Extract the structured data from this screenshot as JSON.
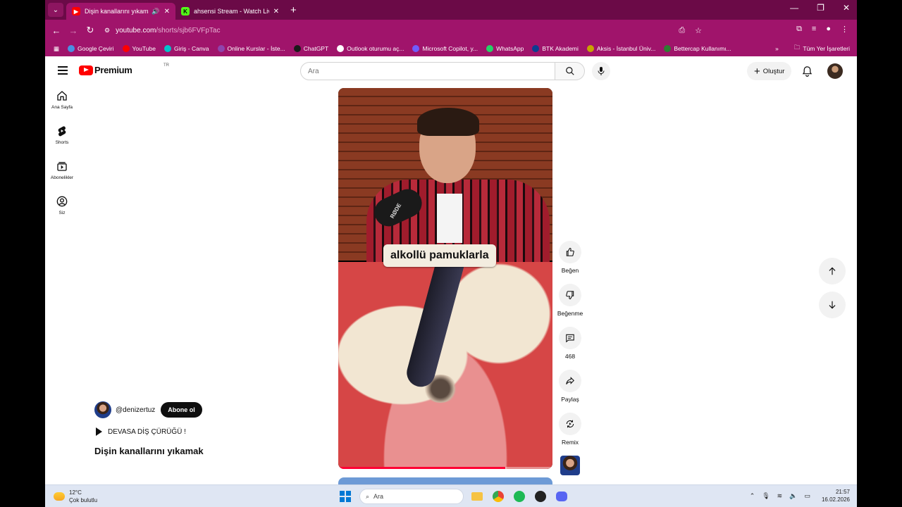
{
  "browser": {
    "tabs": [
      {
        "title": "Dişin kanallarını yıkamak - Y",
        "active": true
      },
      {
        "title": "ahsensi Stream - Watch Live on",
        "active": false
      }
    ],
    "url_host": "youtube.com",
    "url_path": "/shorts/sjb6FVFpTac",
    "bookmarks": [
      "Google Çeviri",
      "YouTube",
      "Giriş - Canva",
      "Online Kurslar - İste...",
      "ChatGPT",
      "Outlook oturumu aç...",
      "Microsoft Copilot, y...",
      "WhatsApp",
      "BTK Akademi",
      "Aksis - İstanbul Üniv...",
      "Bettercap Kullanımı..."
    ],
    "bookmarks_more": "»",
    "all_bookmarks": "Tüm Yer İşaretleri",
    "bookmark_colors": [
      "#4a90e2",
      "#ff0000",
      "#00c4cc",
      "#8e44ad",
      "#1a1a1a",
      "#ffffff",
      "#6f5cff",
      "#25d366",
      "#0b3d91",
      "#c8a400",
      "#2e7d32"
    ]
  },
  "youtube": {
    "logo_text": "Premium",
    "region": "TR",
    "search_placeholder": "Ara",
    "create_label": "Oluştur",
    "sidebar": [
      {
        "label": "Ana Sayfa",
        "icon": "home-icon"
      },
      {
        "label": "Shorts",
        "icon": "shorts-icon"
      },
      {
        "label": "Abonelikler",
        "icon": "subscriptions-icon"
      },
      {
        "label": "Siz",
        "icon": "you-icon"
      }
    ],
    "video": {
      "caption": "alkollü pamuklarla",
      "mic_brand": "RØDE",
      "progress_fraction": 0.78
    },
    "actions": {
      "like": "Beğen",
      "dislike": "Beğenme",
      "comments": "468",
      "share": "Paylaş",
      "remix": "Remix"
    },
    "channel": {
      "handle": "@denizertuz",
      "subscribe": "Abone ol"
    },
    "playlist": "DEVASA DİŞ ÇÜRÜĞÜ !",
    "title": "Dişin kanallarını yıkamak"
  },
  "taskbar": {
    "temperature": "12°C",
    "weather": "Çok bulutlu",
    "search": "Ara",
    "time": "21:57",
    "date": "16.02.2026"
  }
}
